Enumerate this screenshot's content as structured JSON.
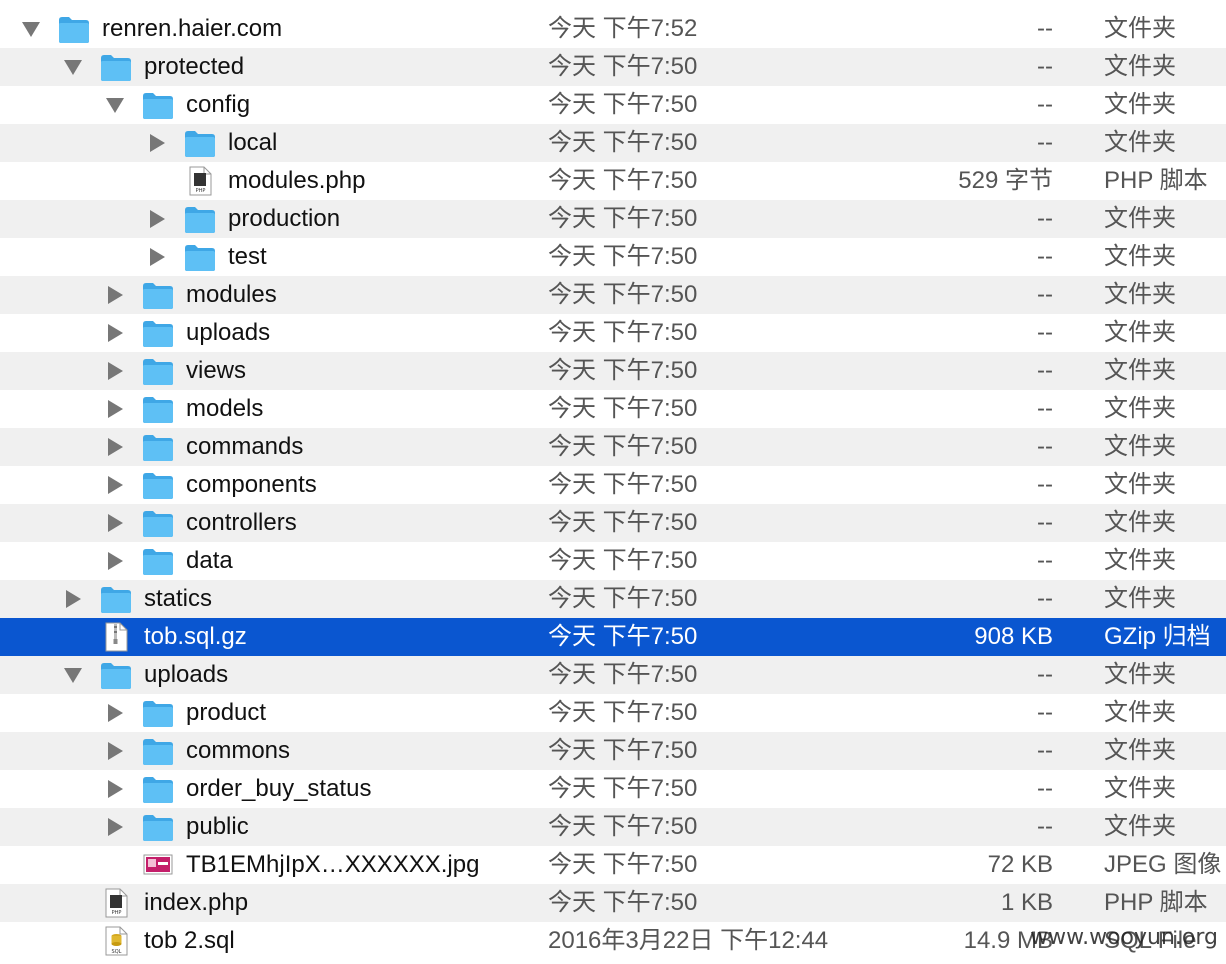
{
  "watermark": "www.wooyun.org",
  "rows": [
    {
      "depth": 0,
      "disclosure": "open",
      "icon": "folder",
      "name": "renren.haier.com",
      "date": "今天 下午7:52",
      "size": "--",
      "kind": "文件夹"
    },
    {
      "depth": 1,
      "disclosure": "open",
      "icon": "folder",
      "name": "protected",
      "date": "今天 下午7:50",
      "size": "--",
      "kind": "文件夹"
    },
    {
      "depth": 2,
      "disclosure": "open",
      "icon": "folder",
      "name": "config",
      "date": "今天 下午7:50",
      "size": "--",
      "kind": "文件夹"
    },
    {
      "depth": 3,
      "disclosure": "closed",
      "icon": "folder",
      "name": "local",
      "date": "今天 下午7:50",
      "size": "--",
      "kind": "文件夹"
    },
    {
      "depth": 3,
      "disclosure": "none",
      "icon": "php",
      "name": "modules.php",
      "date": "今天 下午7:50",
      "size": "529 字节",
      "kind": "PHP 脚本"
    },
    {
      "depth": 3,
      "disclosure": "closed",
      "icon": "folder",
      "name": "production",
      "date": "今天 下午7:50",
      "size": "--",
      "kind": "文件夹"
    },
    {
      "depth": 3,
      "disclosure": "closed",
      "icon": "folder",
      "name": "test",
      "date": "今天 下午7:50",
      "size": "--",
      "kind": "文件夹"
    },
    {
      "depth": 2,
      "disclosure": "closed",
      "icon": "folder",
      "name": "modules",
      "date": "今天 下午7:50",
      "size": "--",
      "kind": "文件夹"
    },
    {
      "depth": 2,
      "disclosure": "closed",
      "icon": "folder",
      "name": "uploads",
      "date": "今天 下午7:50",
      "size": "--",
      "kind": "文件夹"
    },
    {
      "depth": 2,
      "disclosure": "closed",
      "icon": "folder",
      "name": "views",
      "date": "今天 下午7:50",
      "size": "--",
      "kind": "文件夹"
    },
    {
      "depth": 2,
      "disclosure": "closed",
      "icon": "folder",
      "name": "models",
      "date": "今天 下午7:50",
      "size": "--",
      "kind": "文件夹"
    },
    {
      "depth": 2,
      "disclosure": "closed",
      "icon": "folder",
      "name": "commands",
      "date": "今天 下午7:50",
      "size": "--",
      "kind": "文件夹"
    },
    {
      "depth": 2,
      "disclosure": "closed",
      "icon": "folder",
      "name": "components",
      "date": "今天 下午7:50",
      "size": "--",
      "kind": "文件夹"
    },
    {
      "depth": 2,
      "disclosure": "closed",
      "icon": "folder",
      "name": "controllers",
      "date": "今天 下午7:50",
      "size": "--",
      "kind": "文件夹"
    },
    {
      "depth": 2,
      "disclosure": "closed",
      "icon": "folder",
      "name": "data",
      "date": "今天 下午7:50",
      "size": "--",
      "kind": "文件夹"
    },
    {
      "depth": 1,
      "disclosure": "closed",
      "icon": "folder",
      "name": "statics",
      "date": "今天 下午7:50",
      "size": "--",
      "kind": "文件夹"
    },
    {
      "depth": 1,
      "disclosure": "none",
      "icon": "zip",
      "name": "tob.sql.gz",
      "date": "今天 下午7:50",
      "size": "908 KB",
      "kind": "GZip 归档",
      "selected": true
    },
    {
      "depth": 1,
      "disclosure": "open",
      "icon": "folder",
      "name": "uploads",
      "date": "今天 下午7:50",
      "size": "--",
      "kind": "文件夹"
    },
    {
      "depth": 2,
      "disclosure": "closed",
      "icon": "folder",
      "name": "product",
      "date": "今天 下午7:50",
      "size": "--",
      "kind": "文件夹"
    },
    {
      "depth": 2,
      "disclosure": "closed",
      "icon": "folder",
      "name": "commons",
      "date": "今天 下午7:50",
      "size": "--",
      "kind": "文件夹"
    },
    {
      "depth": 2,
      "disclosure": "closed",
      "icon": "folder",
      "name": "order_buy_status",
      "date": "今天 下午7:50",
      "size": "--",
      "kind": "文件夹"
    },
    {
      "depth": 2,
      "disclosure": "closed",
      "icon": "folder",
      "name": "public",
      "date": "今天 下午7:50",
      "size": "--",
      "kind": "文件夹"
    },
    {
      "depth": 2,
      "disclosure": "none",
      "icon": "image",
      "name": "TB1EMhjIpX…XXXXXX.jpg",
      "date": "今天 下午7:50",
      "size": "72 KB",
      "kind": "JPEG 图像"
    },
    {
      "depth": 1,
      "disclosure": "none",
      "icon": "php",
      "name": "index.php",
      "date": "今天 下午7:50",
      "size": "1 KB",
      "kind": "PHP 脚本"
    },
    {
      "depth": 1,
      "disclosure": "none",
      "icon": "sql",
      "name": "tob 2.sql",
      "date": "2016年3月22日 下午12:44",
      "size": "14.9 MB",
      "kind": "SQL File"
    }
  ],
  "colors": {
    "folder": "#5ec0f5",
    "folder_dark": "#3fa7e6",
    "selection": "#0a56d0",
    "stripe": "#f0f0f0"
  }
}
